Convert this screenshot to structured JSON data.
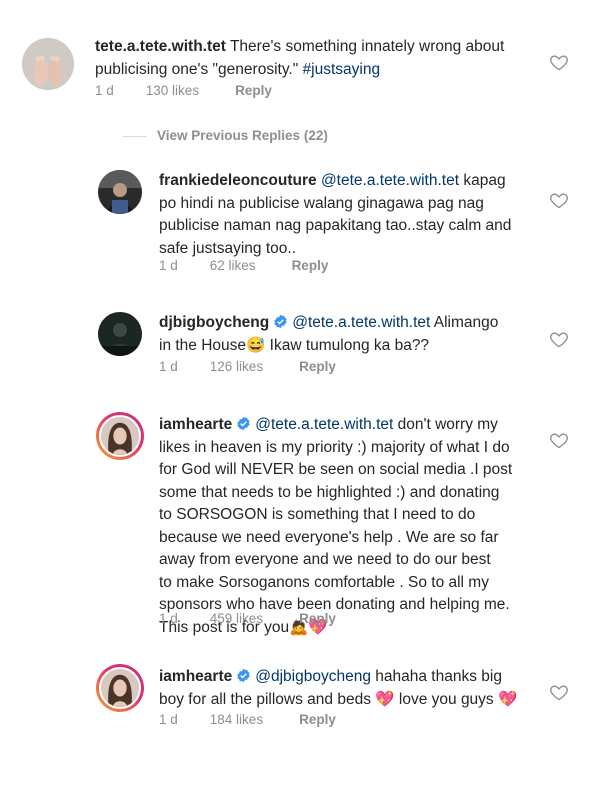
{
  "comments": [
    {
      "username": "tete.a.tete.with.tet",
      "text_before_tag": " There's something innately wrong about\npublicising one's \"generosity.\" ",
      "hashtag": "#justsaying",
      "time": "1 d",
      "likes": "130 likes",
      "reply": "Reply"
    },
    {
      "username": "frankiedeleoncouture",
      "mention": "@tete.a.tete.with.tet",
      "text": "  kapag\npo hindi na publicise walang ginagawa pag nag\npublicise naman nag papakitang tao..stay calm and\nsafe justsaying too..",
      "time": "1 d",
      "likes": "62 likes",
      "reply": "Reply"
    },
    {
      "username": "djbigboycheng",
      "mention": "@tete.a.tete.with.tet",
      "text_1": " Alimango\nin the House",
      "emoji": "😅",
      "text_2": " Ikaw tumulong ka ba??",
      "time": "1 d",
      "likes": "126 likes",
      "reply": "Reply"
    },
    {
      "username": "iamhearte",
      "mention": "@tete.a.tete.with.tet",
      "text": " don't worry my\nlikes in heaven is my priority :) majority of what I do\nfor God will NEVER be seen on social media .I post\nsome that needs to be highlighted :) and donating\nto SORSOGON is something that I need to do\nbecause we need everyone's help . We are so far\naway from everyone and we need to do our best\nto make Sorsoganons comfortable . So to all my\nsponsors who have been donating and helping me.\nThis post is for you",
      "emoji": "🙇💖",
      "time": "1 d",
      "likes": "459 likes",
      "reply": "Reply"
    },
    {
      "username": "iamhearte",
      "mention": "@djbigboycheng",
      "text_1": " hahaha thanks big\nboy for all the pillows and beds ",
      "emoji_1": "💖",
      "text_2": " love you guys ",
      "emoji_2": "💖",
      "time": "1 d",
      "likes": "184 likes",
      "reply": "Reply"
    }
  ],
  "view_previous_replies": "View Previous Replies (22)",
  "colors": {
    "text": "#262626",
    "link": "#00376b",
    "meta": "#8e8e8e",
    "verified": "#3897f0",
    "story_ring": "#e1306c"
  }
}
